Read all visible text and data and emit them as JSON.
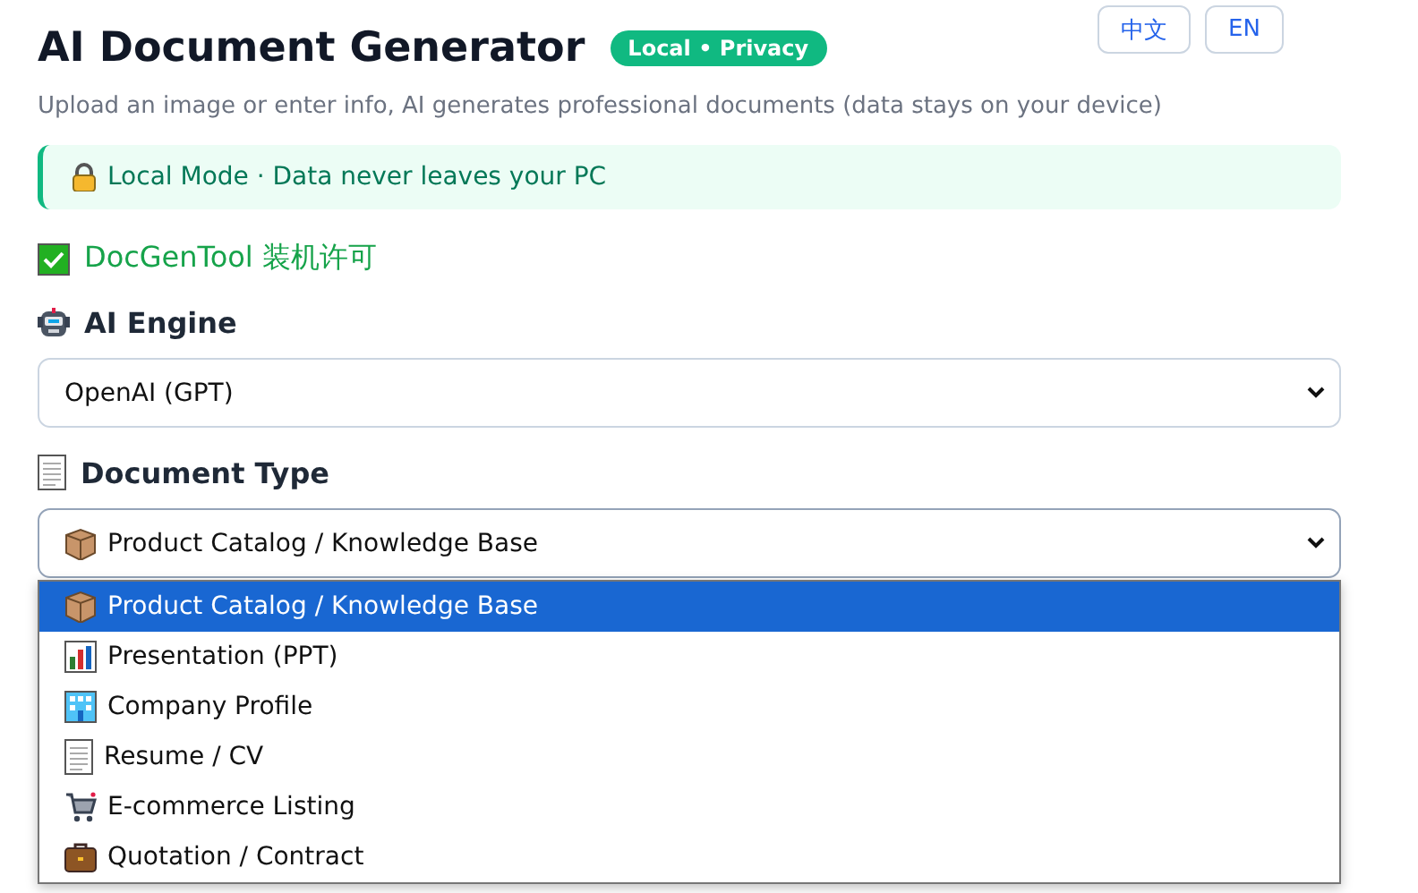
{
  "header": {
    "title": "AI Document Generator",
    "badge": "Local • Privacy",
    "languages": [
      "中文",
      "EN"
    ]
  },
  "subtitle": "Upload an image or enter info, AI generates professional documents (data stays on your device)",
  "banner": {
    "text": "Local Mode · Data never leaves your PC"
  },
  "license": {
    "text": "DocGenTool 装机许可",
    "checked": true
  },
  "fields": [
    {
      "label": "AI Engine",
      "value": "OpenAI (GPT)",
      "expanded": false
    },
    {
      "label": "Document Type",
      "value": "Product Catalog / Knowledge Base",
      "expanded": true,
      "options": [
        {
          "label": "Product Catalog / Knowledge Base",
          "selected": true
        },
        {
          "label": "Presentation (PPT)",
          "selected": false
        },
        {
          "label": "Company Profile",
          "selected": false
        },
        {
          "label": "Resume / CV",
          "selected": false
        },
        {
          "label": "E-commerce Listing",
          "selected": false
        },
        {
          "label": "Quotation / Contract",
          "selected": false
        }
      ]
    }
  ]
}
